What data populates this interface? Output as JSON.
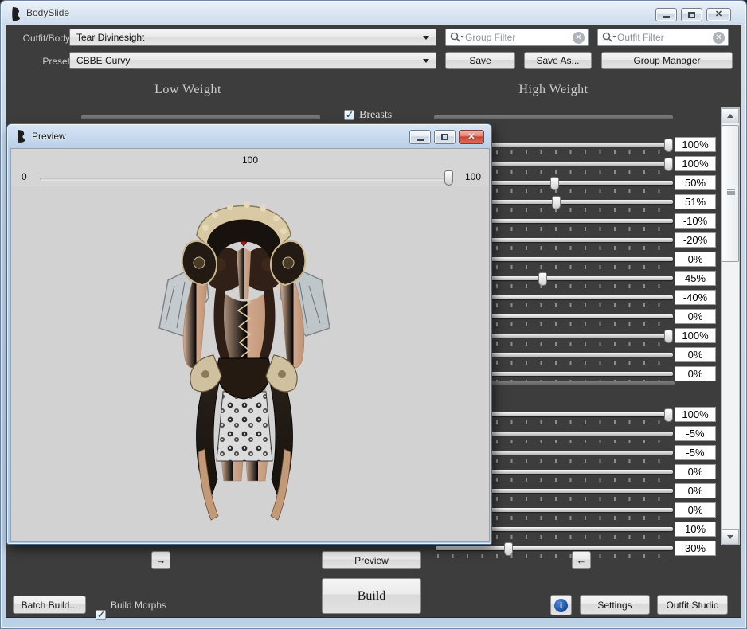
{
  "window": {
    "title": "BodySlide"
  },
  "toolbar": {
    "outfit_label": "Outfit/Body",
    "outfit_value": "Tear Divinesight",
    "preset_label": "Preset",
    "preset_value": "CBBE Curvy",
    "group_filter_placeholder": "Group Filter",
    "outfit_filter_placeholder": "Outfit Filter",
    "save_label": "Save",
    "save_as_label": "Save As...",
    "group_manager_label": "Group Manager"
  },
  "headers": {
    "low_weight": "Low Weight",
    "high_weight": "High Weight"
  },
  "category": {
    "label": "Breasts",
    "checked": true
  },
  "sliders": {
    "group1": [
      {
        "value": 100,
        "label": "100%"
      },
      {
        "value": 100,
        "label": "100%"
      },
      {
        "value": 50,
        "label": "50%"
      },
      {
        "value": 51,
        "label": "51%"
      },
      {
        "value": -10,
        "label": "-10%"
      },
      {
        "value": -20,
        "label": "-20%"
      },
      {
        "value": 0,
        "label": "0%"
      },
      {
        "value": 45,
        "label": "45%"
      },
      {
        "value": -40,
        "label": "-40%"
      },
      {
        "value": 0,
        "label": "0%"
      },
      {
        "value": 100,
        "label": "100%"
      },
      {
        "value": 0,
        "label": "0%"
      },
      {
        "value": 0,
        "label": "0%"
      }
    ],
    "group2": [
      {
        "value": 100,
        "label": "100%"
      },
      {
        "value": -5,
        "label": "-5%"
      },
      {
        "value": -5,
        "label": "-5%"
      },
      {
        "value": 0,
        "label": "0%"
      },
      {
        "value": 0,
        "label": "0%"
      },
      {
        "value": 0,
        "label": "0%"
      },
      {
        "value": 10,
        "label": "10%"
      },
      {
        "value": 30,
        "label": "30%"
      }
    ]
  },
  "preview": {
    "title": "Preview",
    "weight_value": "100",
    "weight_min": "0",
    "weight_max": "100"
  },
  "footer": {
    "low_nav_label": "→",
    "high_nav_label": "←",
    "preview_label": "Preview",
    "build_label": "Build",
    "batch_build_label": "Batch Build...",
    "build_morphs_label": "Build Morphs",
    "build_morphs_checked": true,
    "settings_label": "Settings",
    "outfit_studio_label": "Outfit Studio"
  }
}
